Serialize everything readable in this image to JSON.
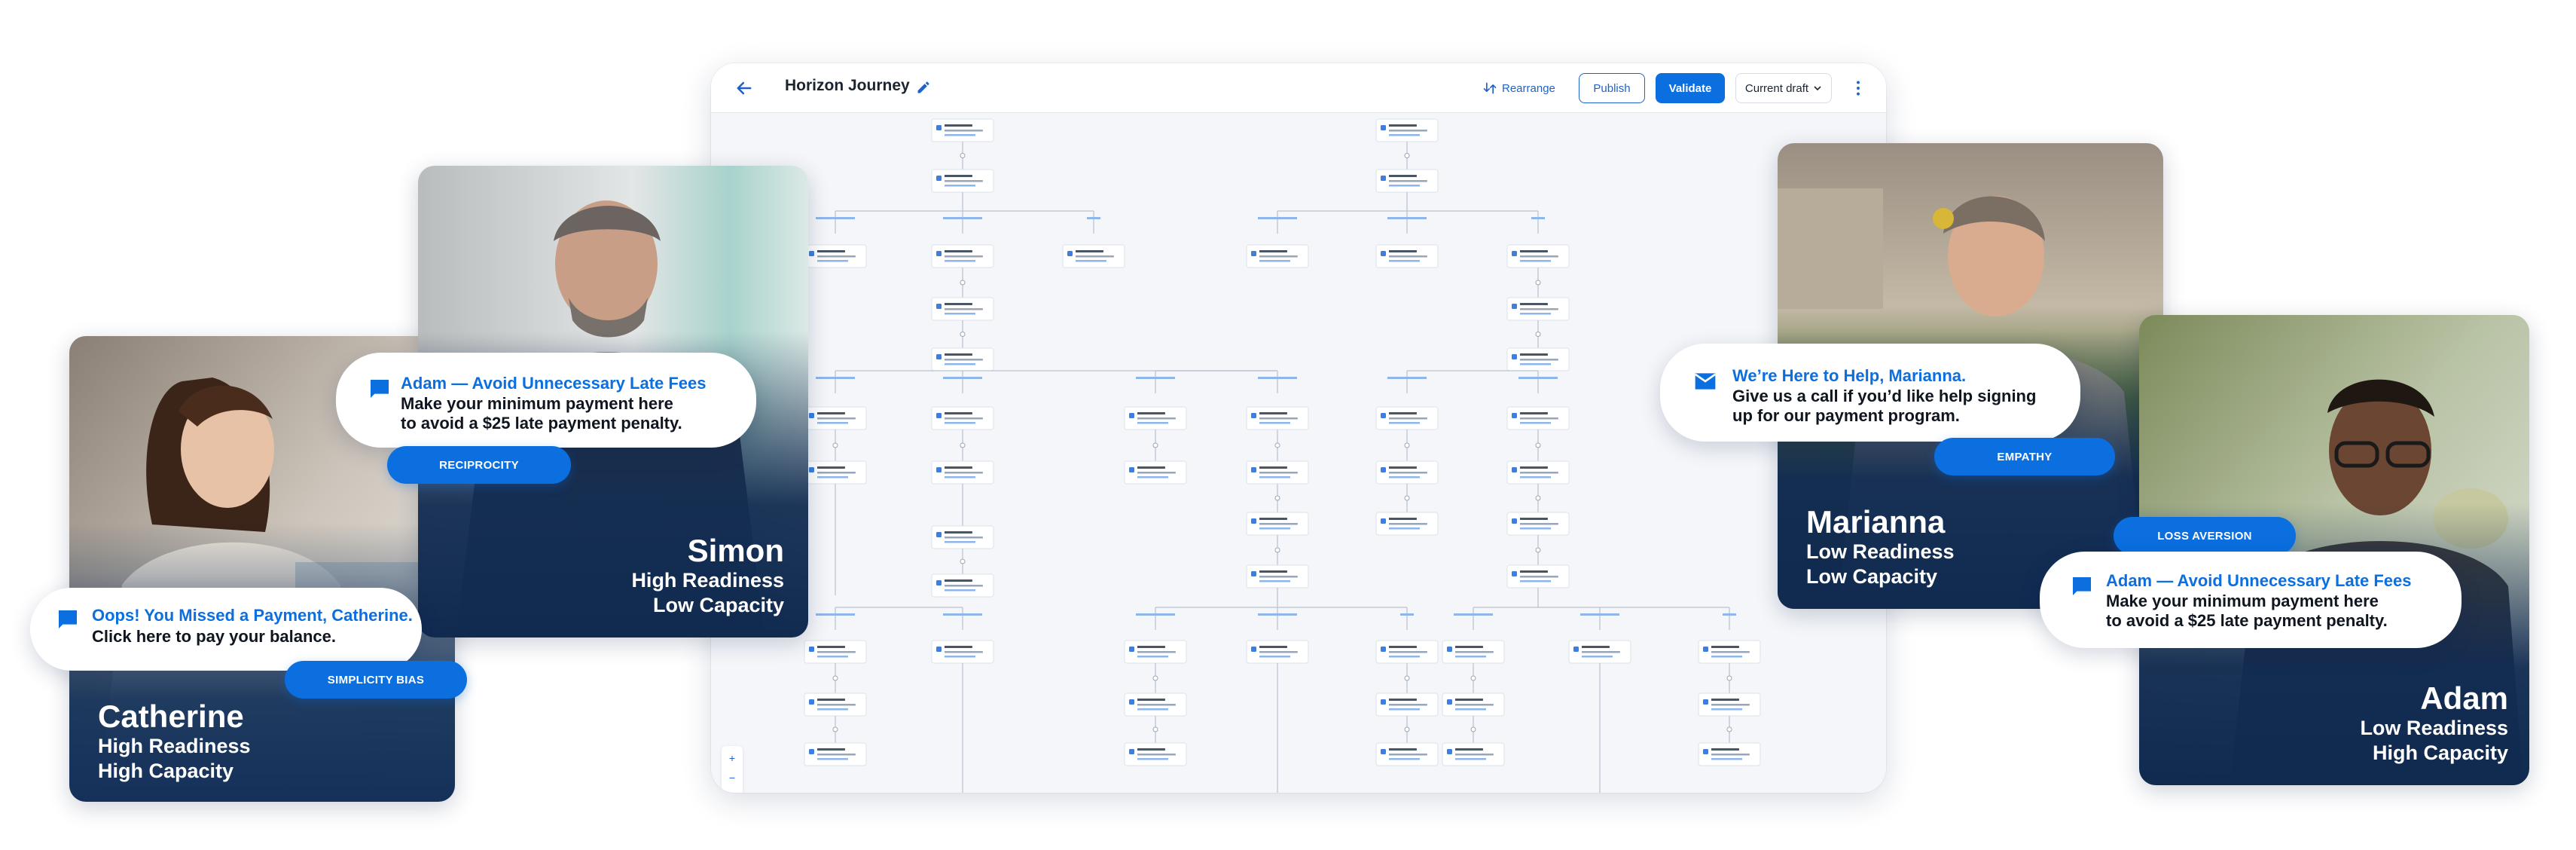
{
  "app": {
    "title": "Horizon Journey",
    "rearrange_label": "Rearrange",
    "publish_label": "Publish",
    "validate_label": "Validate",
    "draft_label": "Current draft",
    "accent": "#0b6fe0"
  },
  "personas": {
    "catherine": {
      "name": "Catherine",
      "readiness": "High Readiness",
      "capacity": "High Capacity"
    },
    "simon": {
      "name": "Simon",
      "readiness": "High Readiness",
      "capacity": "Low Capacity"
    },
    "marianna": {
      "name": "Marianna",
      "readiness": "Low Readiness",
      "capacity": "Low Capacity"
    },
    "adam": {
      "name": "Adam",
      "readiness": "Low Readiness",
      "capacity": "High Capacity"
    }
  },
  "messages": {
    "catherine": {
      "title": "Oops! You Missed a Payment, Catherine.",
      "body": "Click here to pay your balance.",
      "tag": "SIMPLICITY BIAS",
      "icon": "chat-icon"
    },
    "simon": {
      "title": "Adam — Avoid Unnecessary Late Fees",
      "body_line1": "Make your minimum payment here",
      "body_line2": "to avoid a $25 late payment penalty.",
      "tag": "RECIPROCITY",
      "icon": "chat-icon"
    },
    "marianna": {
      "title": "We’re Here to Help, Marianna.",
      "body_line1": "Give us a call if you’d like help signing",
      "body_line2": "up for our payment program.",
      "tag": "EMPATHY",
      "icon": "mail-icon"
    },
    "adam": {
      "title": "Adam — Avoid Unnecessary Late Fees",
      "body_line1": "Make your minimum payment here",
      "body_line2": "to avoid a $25 late payment penalty.",
      "tag": "LOSS AVERSION",
      "icon": "chat-icon"
    }
  }
}
